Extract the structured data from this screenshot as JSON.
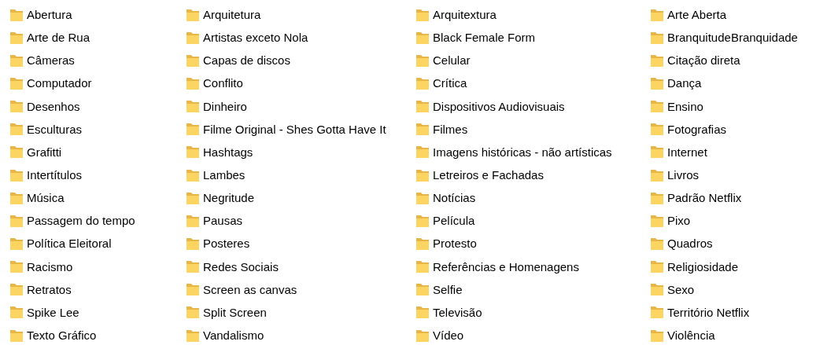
{
  "folders": [
    "Abertura",
    "Arte de Rua",
    "Câmeras",
    "Computador",
    "Desenhos",
    "Esculturas",
    "Grafitti",
    "Intertítulos",
    "Música",
    "Passagem do tempo",
    "Política Eleitoral",
    "Racismo",
    "Retratos",
    "Spike Lee",
    "Texto Gráfico",
    "Arquitetura",
    "Artistas exceto Nola",
    "Capas de discos",
    "Conflito",
    "Dinheiro",
    "Filme Original - Shes Gotta Have It",
    "Hashtags",
    "Lambes",
    "Negritude",
    "Pausas",
    "Posteres",
    "Redes Sociais",
    "Screen as canvas",
    "Split Screen",
    "Vandalismo",
    "Arquitextura",
    "Black Female Form",
    "Celular",
    "Crítica",
    "Dispositivos Audiovisuais",
    "Filmes",
    "Imagens históricas - não artísticas",
    "Letreiros e Fachadas",
    "Notícias",
    "Película",
    "Protesto",
    "Referências e Homenagens",
    "Selfie",
    "Televisão",
    "Vídeo",
    "Arte Aberta",
    "BranquitudeBranquidade",
    "Citação direta",
    "Dança",
    "Ensino",
    "Fotografias",
    "Internet",
    "Livros",
    "Padrão Netflix",
    "Pixo",
    "Quadros",
    "Religiosidade",
    "Sexo",
    "Território Netflix",
    "Violência"
  ]
}
